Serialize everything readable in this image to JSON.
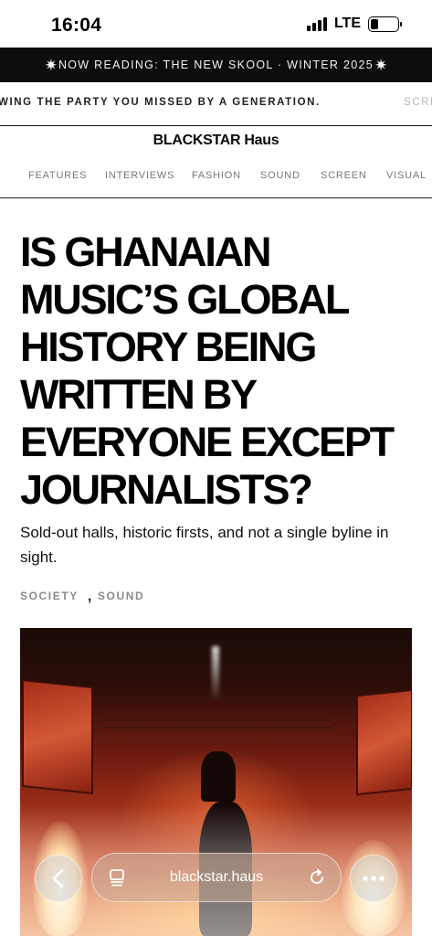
{
  "status_bar": {
    "time": "16:04",
    "network": "LTE",
    "battery_level": 0.3
  },
  "banner": {
    "star_left": "✷",
    "text": "NOW READING: THE NEW SKOOL · WINTER 2025",
    "star_right": "✷"
  },
  "ticker": {
    "text": "WING THE PARTY YOU MISSED BY A GENERATION.",
    "next_text": "SCRE"
  },
  "logo": "BLACKSTAR Haus",
  "nav": {
    "items": [
      "FEATURES",
      "INTERVIEWS",
      "FASHION",
      "SOUND",
      "SCREEN",
      "VISUAL"
    ]
  },
  "article": {
    "headline": "IS GHANAIAN MUSIC’S GLOBAL HISTORY BEING WRITTEN BY EVERYONE EXCEPT JOURNALISTS?",
    "standfirst": "Sold-out halls, historic firsts, and not a single byline in sight.",
    "tags": [
      "SOCIETY",
      "SOUND"
    ],
    "tag_separator": ","
  },
  "browser": {
    "url": "blackstar.haus",
    "back_icon": "chevron-left-icon",
    "tabs_icon": "tabs-icon",
    "reload_icon": "reload-icon",
    "more_icon": "more-dots-icon"
  }
}
